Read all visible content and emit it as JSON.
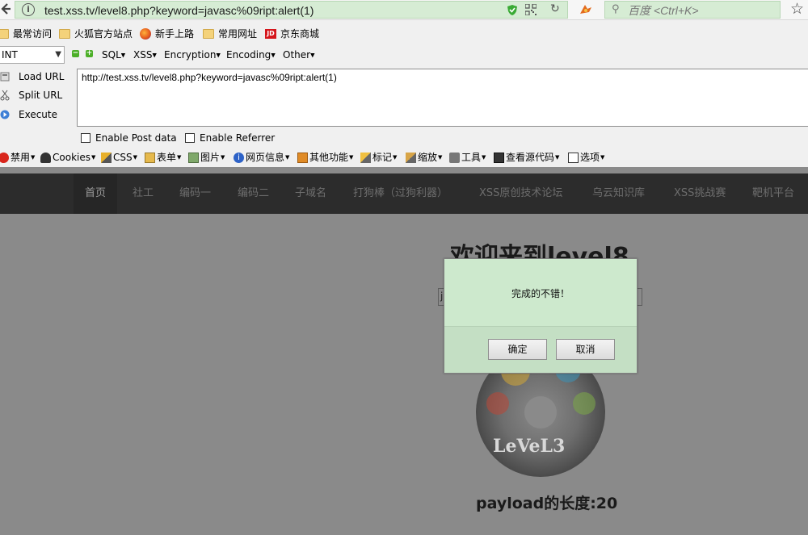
{
  "browser": {
    "url": "test.xss.tv/level8.php?keyword=javasc%09ript:alert(1)",
    "search_placeholder": "百度 <Ctrl+K>"
  },
  "bookmarks": [
    {
      "label": "最常访问",
      "icon": "folder-icon"
    },
    {
      "label": "火狐官方站点",
      "icon": "folder-icon"
    },
    {
      "label": "新手上路",
      "icon": "firefox-icon"
    },
    {
      "label": "常用网址",
      "icon": "folder-icon"
    },
    {
      "label": "京东商城",
      "icon": "jd-icon",
      "icon_text": "JD"
    }
  ],
  "hackbar": {
    "select_value": "INT",
    "menus": [
      "SQL",
      "XSS",
      "Encryption",
      "Encoding",
      "Other"
    ],
    "load_url": "Load URL",
    "split_url": "Split URL",
    "execute": "Execute",
    "url_text": "http://test.xss.tv/level8.php?keyword=javasc%09ript:alert(1)",
    "enable_post": "Enable Post data",
    "enable_referrer": "Enable Referrer"
  },
  "webdev_toolbar": [
    "禁用",
    "Cookies",
    "CSS",
    "表单",
    "图片",
    "网页信息",
    "其他功能",
    "标记",
    "缩放",
    "工具",
    "查看源代码",
    "选项"
  ],
  "page": {
    "nav": [
      "首页",
      "社工",
      "编码一",
      "编码二",
      "子域名",
      "打狗棒（过狗利器）",
      "XSS原创技术论坛",
      "乌云知识库",
      "XSS挑战赛",
      "靶机平台"
    ],
    "title": "欢迎来到level8",
    "input_value": "j",
    "disc_text": "LeVeL3",
    "payload_length": "payload的长度:20"
  },
  "dialog": {
    "message": "完成的不错！",
    "ok": "确定",
    "cancel": "取消"
  },
  "colors": {
    "url_bg": "#d6ecd4",
    "dialog_bg": "#cde9cd",
    "page_bg": "#8a8a8a",
    "navbar_bg": "#2c2c2c"
  }
}
